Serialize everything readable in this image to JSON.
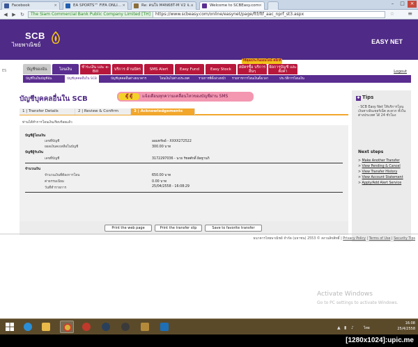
{
  "browser": {
    "tabs": [
      {
        "label": "Facebook",
        "color": "#3b5998"
      },
      {
        "label": "EA SPORTS™ FIFA ONLI…",
        "color": "#1f5fb0"
      },
      {
        "label": "Re: คนใจ M4N68T-M V2 จ…",
        "color": "#8a6d3b"
      },
      {
        "label": "Welcome to SCBEasy.com",
        "color": "#5a2d90"
      }
    ],
    "certificate": "The Siam Commercial Bank Public Company Limited [TH]",
    "url": "https://www.scbeasy.com/online/easynet/page/ftf/ftf_aac_nprf_st3.aspx"
  },
  "header": {
    "logo_en": "SCB",
    "logo_th": "ไทยพาณิชย์",
    "product": "EASY NET",
    "promo": "ใช้คุณประกันออนไลน์ คลิกที่นี่",
    "left_num": "ES"
  },
  "menu": {
    "items": [
      {
        "label": "บัญชีของฉัน"
      },
      {
        "label": "โอนเงิน"
      },
      {
        "label": "ชำระเงิน และ e-Bill"
      },
      {
        "label": "บริการ ด้านบัตร"
      },
      {
        "label": "SMS Alert"
      },
      {
        "label": "Easy Fund"
      },
      {
        "label": "Easy Stock"
      },
      {
        "label": "สมัครซื้อ บริการอื่นๆ"
      },
      {
        "label": "จัดการบัญชี และตั้งค่า"
      }
    ],
    "logout": "Logout"
  },
  "submenu": {
    "items": [
      {
        "label": "บัญชีใบเงินบัญชีฉัน"
      },
      {
        "label": "บัญชีบุคคลอื่นใน SCB"
      },
      {
        "label": "บัญชีบุคคลอื่นต่างธนาคาร"
      },
      {
        "label": "โอนเงินไปต่างประเทศ"
      },
      {
        "label": "รายการที่ตั้งล่วงหน้า"
      },
      {
        "label": "รายการการโอนเงินตั้งเวลา"
      },
      {
        "label": "ประวัติการโอนเงิน"
      }
    ]
  },
  "content": {
    "title": "บัญชีบุคคลอื่นใน SCB",
    "banner_badge": "ตู๊ ตู๊",
    "banner_text": "แจ้งเตือนทุกความเคลื่อนไหวของบัญชีผ่าน SMS",
    "steps": [
      {
        "label": "1 | Transfer Details"
      },
      {
        "label": "2 | Review & Confirm"
      },
      {
        "label": "3 | Acknowledgements"
      }
    ],
    "note": "ท่านได้ทำการโอนเงินเรียบร้อยแล้ว",
    "from_section": "บัญชีผู้โอนเงิน",
    "from_rows": [
      {
        "label": "เลขที่บัญชี",
        "value": "ออมทรัพย์ - XXXX272522"
      },
      {
        "label": "ยอดเงินคงเหลือในบัญชี",
        "value": "300.00 บาท"
      }
    ],
    "to_section": "บัญชีผู้รับเงิน",
    "to_rows": [
      {
        "label": "เลขที่บัญชี",
        "value": "3172297036 - นาย รัชตศักดิ์ ผิดฐานกิ"
      }
    ],
    "amount_section": "จำนวนเงิน",
    "amount_rows": [
      {
        "label": "จำนวนเงินที่ต้องการโอน",
        "value": "650.00 บาท"
      },
      {
        "label": "ค่าธรรมเนียม",
        "value": "0.00  บาท"
      },
      {
        "label": "วันที่ทำรายการ",
        "value": "25/04/2558 - 16:08:29"
      }
    ],
    "buttons": {
      "print_page": "Print the web page",
      "print_slip": "Print the transfer slip",
      "save_favorite": "Save to favorite transfer"
    }
  },
  "sidebar": {
    "tips_title": "Tips",
    "tips_text": "- SCB Easy Net ให้บริการโอนเงินทางอินเทอร์เน็ต สะดวก ทั้งใน ต่างประเทศ ได้ 24 ชั่วโมง",
    "next_title": "Next steps",
    "links": [
      {
        "label": "Make Another Transfer"
      },
      {
        "label": "View Pending & Cancel"
      },
      {
        "label": "View Transfer History"
      },
      {
        "label": "View Account Statement"
      },
      {
        "label": "Apply/Add Alert Service"
      }
    ]
  },
  "footer": {
    "copyright": "ธนาคารไทยพาณิชย์ จำกัด (มหาชน) 2553 © สงวนลิขสิทธิ์",
    "privacy": "Privacy Policy",
    "terms": "Terms of Use",
    "security": "Security Tips"
  },
  "os": {
    "activate_title": "Activate Windows",
    "activate_sub": "Go to PC settings to activate Windows.",
    "time": "16:08",
    "date": "25/4/2558",
    "lang": "ไทย"
  },
  "watermark": "[1280x1024]:upic.me"
}
